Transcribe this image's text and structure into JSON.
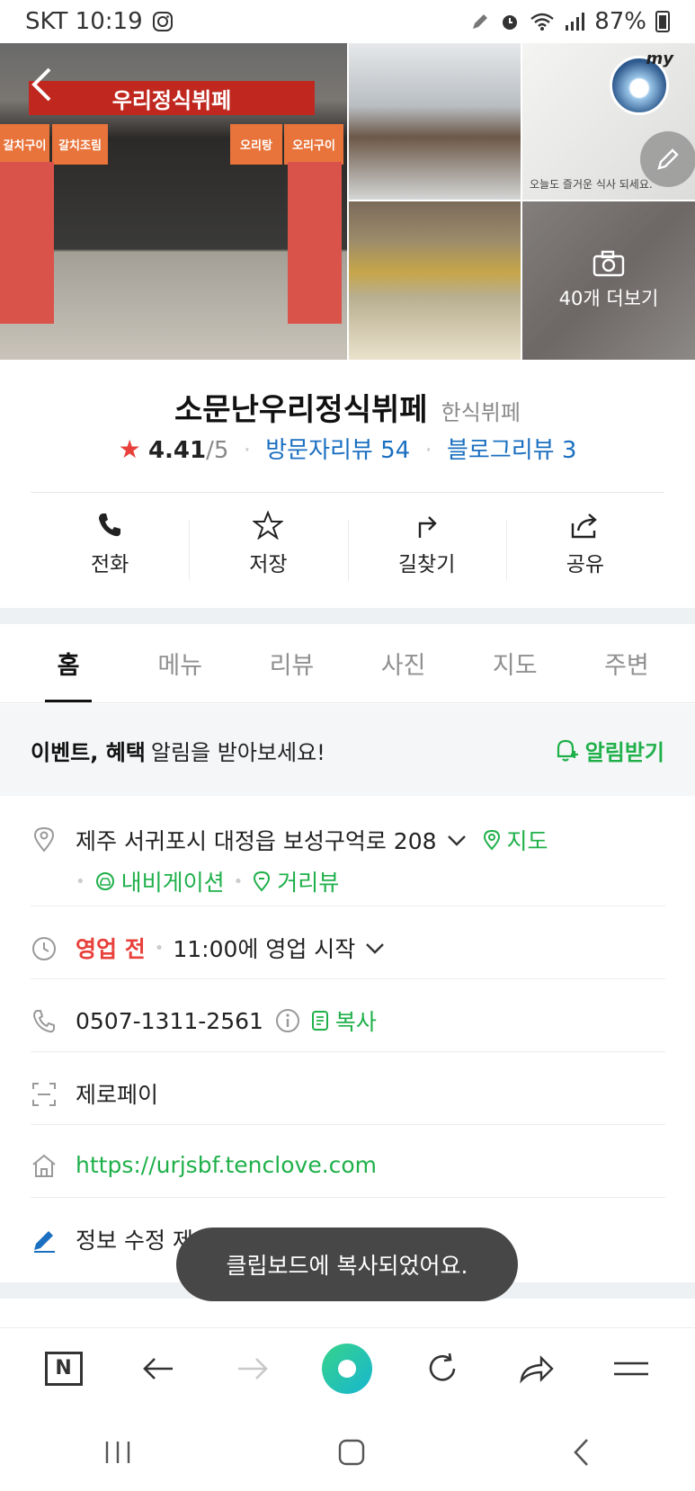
{
  "status_bar": {
    "carrier_time": "SKT 10:19",
    "battery": "87%"
  },
  "photos": {
    "sign_text": "우리정식뷔페",
    "panel_texts": [
      "갈치구이",
      "갈치조림",
      "오리탕",
      "오리구이"
    ],
    "wall_text": "오늘도 즐거운 식사 되세요.",
    "more_label": "40개 더보기",
    "badge": "my"
  },
  "place": {
    "name": "소문난우리정식뷔페",
    "category": "한식뷔페",
    "score": "4.41",
    "score_max": "/5",
    "visitor_review": "방문자리뷰 54",
    "blog_review": "블로그리뷰 3"
  },
  "actions": [
    {
      "label": "전화"
    },
    {
      "label": "저장"
    },
    {
      "label": "길찾기"
    },
    {
      "label": "공유"
    }
  ],
  "tabs": [
    {
      "label": "홈"
    },
    {
      "label": "메뉴"
    },
    {
      "label": "리뷰"
    },
    {
      "label": "사진"
    },
    {
      "label": "지도"
    },
    {
      "label": "주변"
    }
  ],
  "event": {
    "bold": "이벤트, 혜택",
    "rest": "알림을 받아보세요!",
    "alert_button": "알림받기"
  },
  "address": {
    "text": "제주 서귀포시 대정읍 보성구억로 208",
    "map": "지도",
    "navigation": "내비게이션",
    "street_view": "거리뷰"
  },
  "hours": {
    "status": "영업 전",
    "detail": "11:00에 영업 시작"
  },
  "phone": {
    "number": "0507-1311-2561",
    "copy": "복사"
  },
  "payment": {
    "text": "제로페이"
  },
  "website": {
    "url": "https://urjsbf.tenclove.com"
  },
  "suggest": {
    "text": "정보 수정 제안하기 >"
  },
  "toast": {
    "text": "클립보드에 복사되었어요."
  },
  "colors": {
    "brand_green": "#1fb04a",
    "link_blue": "#1a6fc0",
    "star_red": "#e8403a"
  }
}
